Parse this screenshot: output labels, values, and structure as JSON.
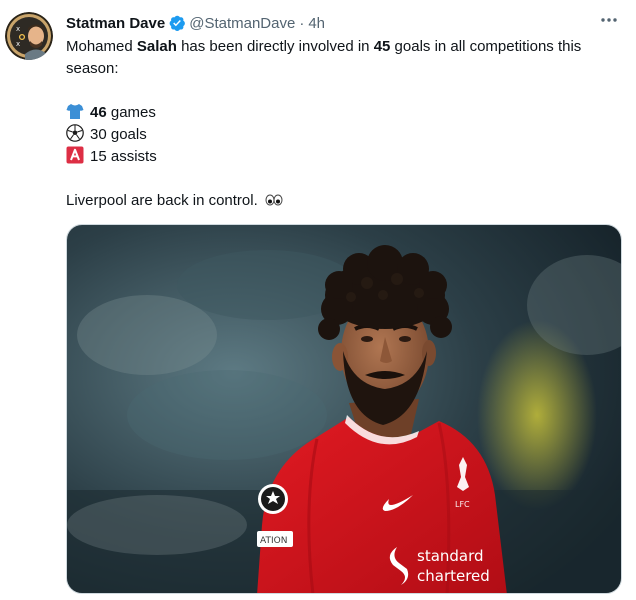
{
  "author": {
    "name": "Statman Dave",
    "handle": "@StatmanDave",
    "separator": "·",
    "time": "4h"
  },
  "tweet": {
    "intro_pre": "Mohamed ",
    "intro_name": "Salah",
    "intro_mid": " has been directly involved in ",
    "intro_num": "45",
    "intro_post": " goals in all competitions this season:",
    "stats": [
      {
        "icon": "shirt-emoji-icon",
        "bold": "46",
        "text": " games"
      },
      {
        "icon": "soccer-ball-emoji-icon",
        "bold": "",
        "text": "30 goals"
      },
      {
        "icon": "letter-a-emoji-icon",
        "bold": "",
        "text": "15 assists"
      }
    ],
    "closing": "Liverpool are back in control.",
    "closing_emoji": "eyes-emoji-icon"
  },
  "media": {
    "description_icon": "player-photo",
    "shirt_text_1": "standard",
    "shirt_text_2": "chartered",
    "sleeve_badge": "ATION"
  },
  "colors": {
    "accent": "#1d9bf0",
    "muted": "#536471",
    "shirt_red": "#d0121b",
    "shirt_blue": "#3b8fd6"
  }
}
